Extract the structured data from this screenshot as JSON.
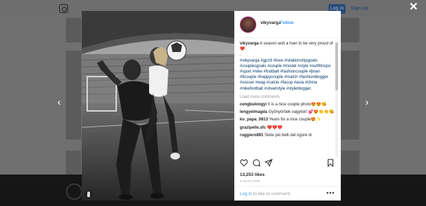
{
  "background_page": {
    "login_label": "Log In",
    "signup_label": "Sign Up"
  },
  "overlay": {
    "close_label": "✕",
    "prev_label": "‹",
    "next_label": "›"
  },
  "post": {
    "username": "vikyvarga",
    "separator": "•",
    "follow_label": "Follow",
    "caption_user": "vikyvarga",
    "caption_text": "A season and a man to be very proud of❤️.",
    "caption_dot": ".",
    "hashtags": "#vikyvarga #gp19 #love #relationshipgoals #couplesgoals #couple #model #style #outfitinspo #sport #nike #football #fashioncouple #jinan #ltcouple #happycouple #match #fashionblogger #soccer #wag #calcio #facup #asia #china #nikefootball #streetstyle #styleblogger.",
    "load_more_label": "Load more comments",
    "comments": [
      {
        "user": "cengbulongyi",
        "text": "It is a nice couple photo😍😍😘"
      },
      {
        "user": "lengyelmagda",
        "text": "Gyönyörűek vagytok! 💕😍👏👏😘"
      },
      {
        "user": "ko_papa_0813",
        "text": "Yeam for a nice couple😍✨"
      },
      {
        "user": "grazipelle.sfc",
        "text": "❤️❤️❤️"
      },
      {
        "user": "ruggiero891",
        "text": "Siete più belli del rigore di"
      }
    ],
    "likes": "13,253 likes",
    "timestamp": "3 DAYS AGO",
    "login_link": "Log in",
    "login_suffix": " to like or comment.",
    "more_label": "•••"
  },
  "icons": {
    "like": "heart-icon",
    "comment": "comment-icon",
    "share": "share-icon",
    "save": "bookmark-icon",
    "tag": "user-tag-icon"
  },
  "colors": {
    "link": "#3897f0",
    "hashtag": "#003569",
    "text": "#262626",
    "muted": "#999999"
  }
}
